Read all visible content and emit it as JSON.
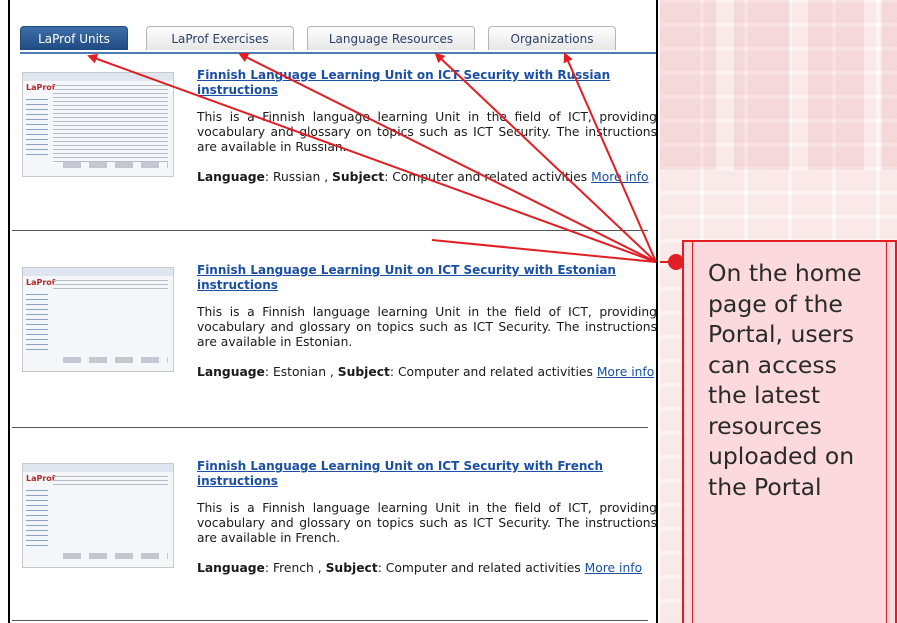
{
  "tabs": [
    {
      "label": "LaProf Units",
      "active": true
    },
    {
      "label": "LaProf Exercises",
      "active": false
    },
    {
      "label": "Language Resources",
      "active": false
    },
    {
      "label": "Organizations",
      "active": false
    }
  ],
  "items": [
    {
      "title": "Finnish Language Learning Unit on ICT Security with Russian instructions",
      "description": "This is a Finnish language learning Unit in the field of ICT, providing vocabulary and glossary on topics such as ICT Security. The instructions are available in Russian.",
      "language_label": "Language",
      "language": "Russian",
      "subject_label": "Subject",
      "subject": "Computer and related activities",
      "more_info": "More info"
    },
    {
      "title": "Finnish Language Learning Unit on ICT Security with Estonian instructions",
      "description": "This is a Finnish language learning Unit in the field of ICT, providing vocabulary and glossary on topics such as ICT Security. The instructions are available in Estonian.",
      "language_label": "Language",
      "language": "Estonian",
      "subject_label": "Subject",
      "subject": "Computer and related activities",
      "more_info": "More info"
    },
    {
      "title": "Finnish Language Learning Unit on ICT Security with French instructions",
      "description": "This is a Finnish language learning Unit in the field of ICT, providing vocabulary and glossary on topics such as ICT Security. The instructions are available in French.",
      "language_label": "Language",
      "language": "French",
      "subject_label": "Subject",
      "subject": "Computer and related activities",
      "more_info": "More info"
    }
  ],
  "thumb_logo": "LaProf",
  "callout": {
    "text": "On the home page of the Portal, users can access the latest resources uploaded on the Portal"
  },
  "colors": {
    "accent": "#e21e25",
    "callout_bg": "#fbd9dc",
    "tab_active": "#1e4a82",
    "link": "#1a4fa3"
  }
}
